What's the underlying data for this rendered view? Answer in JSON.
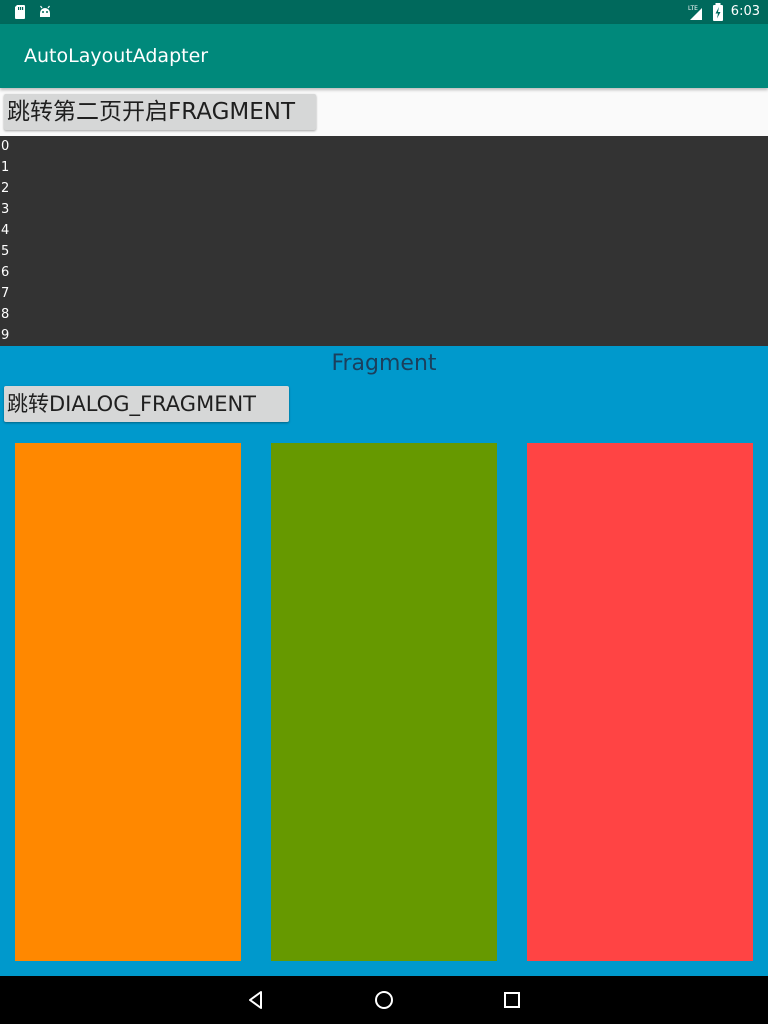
{
  "status_bar": {
    "time": "6:03",
    "network": "LTE",
    "icons": [
      "sd-card-icon",
      "android-debug-icon",
      "lte-signal-icon",
      "battery-charging-icon"
    ],
    "bg_color": "#00695c"
  },
  "app_bar": {
    "title": "AutoLayoutAdapter",
    "bg_color": "#00897b"
  },
  "main": {
    "fragment_button_label": "跳转第二页开启FRAGMENT",
    "list_items": [
      "0",
      "1",
      "2",
      "3",
      "4",
      "5",
      "6",
      "7",
      "8",
      "9"
    ],
    "list_bg_color": "#333333"
  },
  "fragment": {
    "title": "Fragment",
    "dialog_button_label": "跳转DIALOG_FRAGMENT",
    "bg_color": "#0099cc",
    "block_colors": [
      "#ff8800",
      "#669900",
      "#ff4444"
    ]
  },
  "nav_bar": {
    "buttons": [
      "back-icon",
      "home-icon",
      "recents-icon"
    ]
  }
}
